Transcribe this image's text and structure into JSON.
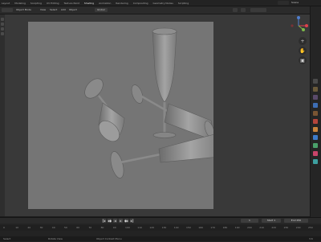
{
  "workspace_tabs": [
    "Layout",
    "Modeling",
    "Sculpting",
    "UV Editing",
    "Texture Paint",
    "Shading",
    "Animation",
    "Rendering",
    "Compositing",
    "Geometry Nodes",
    "Scripting"
  ],
  "active_tab_index": 5,
  "scene_name": "Scene",
  "viewport": {
    "header_mode": "Object Mode",
    "view_label": "View",
    "select_label": "Select",
    "add_label": "Add",
    "object_label": "Object",
    "transform": "Global"
  },
  "timeline": {
    "current_frame": "1",
    "start_label": "Start",
    "start": "1",
    "end_label": "End",
    "end": "250",
    "ticks": [
      "0",
      "10",
      "20",
      "30",
      "40",
      "50",
      "60",
      "70",
      "80",
      "90",
      "100",
      "110",
      "120",
      "130",
      "140",
      "150",
      "160",
      "170",
      "180",
      "190",
      "200",
      "210",
      "220",
      "230",
      "240",
      "250"
    ]
  },
  "statusbar": {
    "select": "Select",
    "rotate": "Rotate View",
    "menu": "Object Context Menu",
    "version": "3.6"
  },
  "colors": {
    "accent": "#3d6eb5",
    "gizmo_x": "#e0414b",
    "gizmo_y": "#7cb94a",
    "gizmo_z": "#4f7fd0",
    "glass_fill": "#9a9a9a"
  }
}
